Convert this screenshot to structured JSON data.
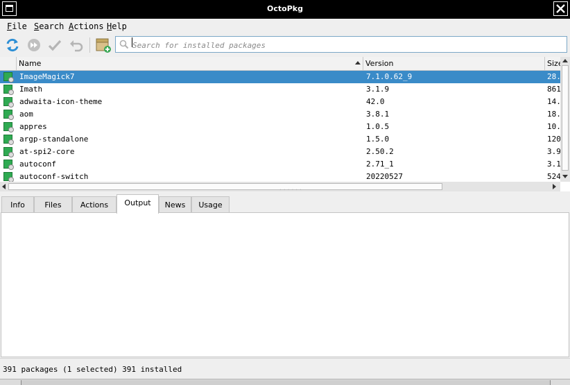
{
  "window": {
    "title": "OctoPkg"
  },
  "menu": [
    {
      "label": "File"
    },
    {
      "label": "Search"
    },
    {
      "label": "Actions"
    },
    {
      "label": "Help"
    }
  ],
  "toolbar": {
    "sync_icon": "sync-icon",
    "forward_icon": "fast-forward-icon",
    "commit_icon": "checkmark-icon",
    "rollback_icon": "undo-icon",
    "install_local_icon": "package-add-icon"
  },
  "search": {
    "placeholder": "Search for installed packages",
    "value": ""
  },
  "table": {
    "columns": {
      "name": "Name",
      "version": "Version",
      "size": "Size"
    },
    "rows": [
      {
        "name": "ImageMagick7",
        "version": "7.1.0.62_9",
        "size": "28.",
        "selected": true
      },
      {
        "name": "Imath",
        "version": "3.1.9",
        "size": "861"
      },
      {
        "name": "adwaita-icon-theme",
        "version": "42.0",
        "size": "14."
      },
      {
        "name": "aom",
        "version": "3.8.1",
        "size": "18."
      },
      {
        "name": "appres",
        "version": "1.0.5",
        "size": "10."
      },
      {
        "name": "argp-standalone",
        "version": "1.5.0",
        "size": "120"
      },
      {
        "name": "at-spi2-core",
        "version": "2.50.2",
        "size": "3.9"
      },
      {
        "name": "autoconf",
        "version": "2.71_1",
        "size": "3.1"
      },
      {
        "name": "autoconf-switch",
        "version": "20220527",
        "size": "524"
      }
    ]
  },
  "tabs": [
    {
      "label": "Info"
    },
    {
      "label": "Files"
    },
    {
      "label": "Actions"
    },
    {
      "label": "Output",
      "active": true
    },
    {
      "label": "News"
    },
    {
      "label": "Usage"
    }
  ],
  "status": {
    "text": "391 packages (1 selected)  391 installed"
  },
  "colors": {
    "selection": "#3a8bc8",
    "package_icon": "#2faa52",
    "sync_icon": "#2d8fd5"
  }
}
